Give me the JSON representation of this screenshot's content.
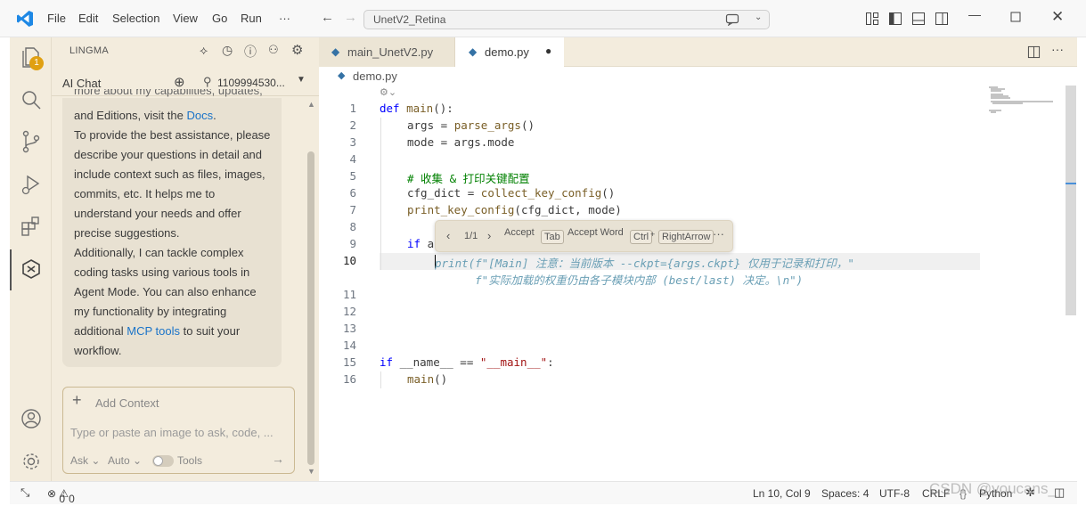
{
  "menu": [
    "File",
    "Edit",
    "Selection",
    "View",
    "Go",
    "Run"
  ],
  "menu_more": "···",
  "title_search": "UnetV2_Retina",
  "activity": {
    "explorer_badge": "1"
  },
  "sidebar": {
    "title": "LINGMA",
    "chat_tab": "AI Chat",
    "account": "1109994530..."
  },
  "chat": {
    "clipped": "more about my capabilities, updates,",
    "l1a": "and Editions, visit the ",
    "l1_link": "Docs",
    "l1b": ".",
    "l2": "To provide the best assistance, please",
    "l3": "describe your questions in detail and",
    "l4": "include context such as files, images,",
    "l5": "commits, etc. It helps me to",
    "l6": "understand your needs and offer",
    "l7": "precise suggestions.",
    "l8": "Additionally, I can tackle complex",
    "l9": "coding tasks using various tools in",
    "l10": "Agent Mode. You can also enhance",
    "l11": "my functionality by integrating",
    "l12a": "additional ",
    "l12_link": "MCP tools",
    "l12b": " to suit your",
    "l13": "workflow."
  },
  "input": {
    "add_context": "Add Context",
    "placeholder": "Type or paste an image to ask, code, ...",
    "mode": "Ask ⌄",
    "model": "Auto ⌄",
    "tools": "Tools"
  },
  "editor": {
    "tabs": [
      "main_UnetV2.py",
      "demo.py"
    ],
    "breadcrumb": "demo.py",
    "line_numbers": [
      "1",
      "2",
      "3",
      "4",
      "5",
      "6",
      "7",
      "8",
      "9",
      "10",
      "",
      "11",
      "12",
      "13",
      "14",
      "15",
      "16"
    ],
    "code": [
      {
        "indent": 0,
        "tokens": [
          [
            "kw",
            "def "
          ],
          [
            "fn",
            "main"
          ],
          [
            "",
            "():"
          ]
        ]
      },
      {
        "indent": 1,
        "tokens": [
          [
            "",
            "args = "
          ],
          [
            "fn",
            "parse_args"
          ],
          [
            "",
            "()"
          ]
        ]
      },
      {
        "indent": 1,
        "tokens": [
          [
            "",
            "mode = args.mode"
          ]
        ]
      },
      {
        "indent": 0,
        "tokens": []
      },
      {
        "indent": 1,
        "tokens": [
          [
            "cm",
            "# 收集 & 打印关键配置"
          ]
        ]
      },
      {
        "indent": 1,
        "tokens": [
          [
            "",
            "cfg_dict = "
          ],
          [
            "fn",
            "collect_key_config"
          ],
          [
            "",
            "()"
          ]
        ]
      },
      {
        "indent": 1,
        "tokens": [
          [
            "fn",
            "print_key_config"
          ],
          [
            "",
            "(cfg_dict, mode)"
          ]
        ]
      },
      {
        "indent": 0,
        "tokens": []
      },
      {
        "indent": 1,
        "tokens": [
          [
            "kw",
            "if "
          ],
          [
            "",
            "a"
          ]
        ]
      },
      {
        "indent": 2,
        "tokens": [
          [
            "ghost",
            "print(f\"[Main] 注意：当前版本 --ckpt={args.ckpt} 仅用于记录和打印，\""
          ]
        ]
      },
      {
        "indent": 2,
        "tokens": [
          [
            "ghost",
            "      f\"实际加载的权重仍由各子模块内部 (best/last) 决定。\\n\")"
          ]
        ]
      },
      {
        "indent": 0,
        "tokens": []
      },
      {
        "indent": 0,
        "tokens": []
      },
      {
        "indent": 0,
        "tokens": []
      },
      {
        "indent": 0,
        "tokens": []
      },
      {
        "indent": 0,
        "tokens": [
          [
            "kw",
            "if "
          ],
          [
            "",
            "__name__ == "
          ],
          [
            "str",
            "\"__main__\""
          ],
          [
            "",
            ":"
          ]
        ]
      },
      {
        "indent": 1,
        "tokens": [
          [
            "fn",
            "main"
          ],
          [
            "",
            "()"
          ]
        ]
      }
    ]
  },
  "suggest": {
    "counter": "1/1",
    "accept": "Accept",
    "accept_key": "Tab",
    "accept_word": "Accept Word",
    "ctrl_key": "Ctrl",
    "plus": "+",
    "right_key": "RightArrow"
  },
  "status": {
    "errors": "0",
    "warnings": "0",
    "position": "Ln 10, Col 9",
    "spaces": "Spaces: 4",
    "encoding": "UTF-8",
    "eol": "CRLF",
    "language": "Python"
  },
  "watermark": "CSDN @youcans_"
}
